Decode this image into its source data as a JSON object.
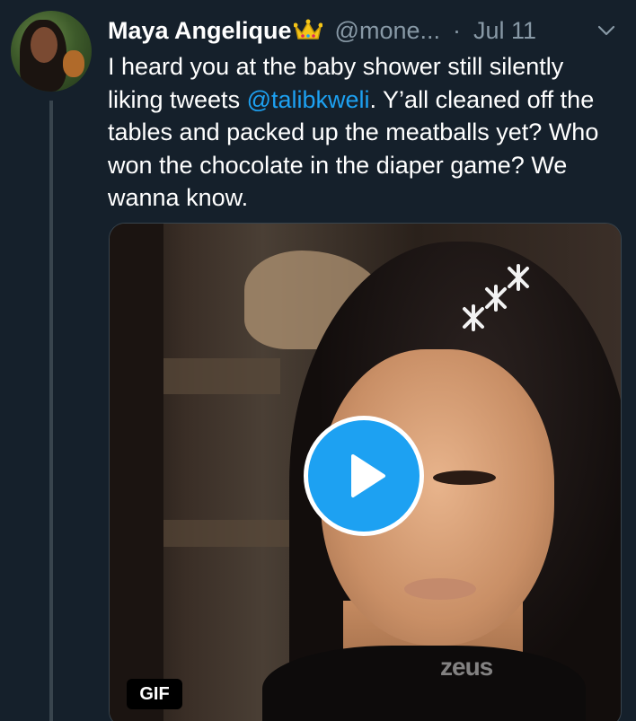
{
  "tweet": {
    "display_name": "Maya Angelique",
    "handle": "@mone...",
    "separator": "·",
    "date": "Jul 11",
    "text_before": "I heard you at the baby shower still silently liking tweets ",
    "mention": "@talibkweli",
    "text_after": ". Y’all cleaned off the tables and packed up the meatballs yet? Who won the chocolate in the diaper game? We wanna know."
  },
  "media": {
    "badge": "GIF",
    "watermark": "zeus"
  },
  "icons": {
    "avatar": "user-avatar",
    "crown": "crown-emoji-icon",
    "more": "chevron-down-icon",
    "play": "play-icon"
  },
  "colors": {
    "background": "#15202b",
    "link": "#1da1f2",
    "secondary_text": "#8899a6",
    "play_button": "#1da1f2"
  }
}
